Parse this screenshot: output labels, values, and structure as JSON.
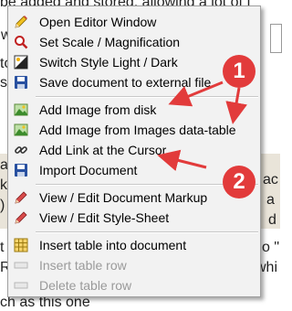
{
  "background": {
    "lines": [
      "be added and stored, allowing a lot of f",
      "w",
      "to",
      "se",
      "an",
      "ki",
      ")",
      "t",
      "Ro",
      "ch as this one"
    ],
    "right_fragments": [
      "ac",
      "a",
      "d",
      "o \"",
      "whi"
    ]
  },
  "menu": {
    "items": [
      {
        "label": "Open Editor Window",
        "icon": "pencil-icon",
        "enabled": true
      },
      {
        "label": "Set Scale / Magnification",
        "icon": "magnifier-icon",
        "enabled": true
      },
      {
        "label": "Switch Style Light / Dark",
        "icon": "light-dark-icon",
        "enabled": true
      },
      {
        "label": "Save document to external file",
        "icon": "save-icon",
        "enabled": true
      },
      {
        "label": "Add Image from disk",
        "icon": "image-icon",
        "enabled": true
      },
      {
        "label": "Add Image from Images data-table",
        "icon": "image-icon",
        "enabled": true
      },
      {
        "label": "Add Link at the Cursor",
        "icon": "link-icon",
        "enabled": true
      },
      {
        "label": "Import Document",
        "icon": "import-icon",
        "enabled": true
      },
      {
        "label": "View / Edit Document Markup",
        "icon": "pencil-red-icon",
        "enabled": true
      },
      {
        "label": "View / Edit Style-Sheet",
        "icon": "pencil-red-icon",
        "enabled": true
      },
      {
        "label": "Insert table into document",
        "icon": "table-icon",
        "enabled": true
      },
      {
        "label": "Insert table row",
        "icon": "table-row-icon",
        "enabled": false
      },
      {
        "label": "Delete table row",
        "icon": "table-row-icon",
        "enabled": false
      }
    ]
  },
  "callouts": [
    {
      "number": "1"
    },
    {
      "number": "2"
    }
  ],
  "colors": {
    "accent_red": "#e23b3b",
    "menu_bg": "#f2f2f2"
  }
}
